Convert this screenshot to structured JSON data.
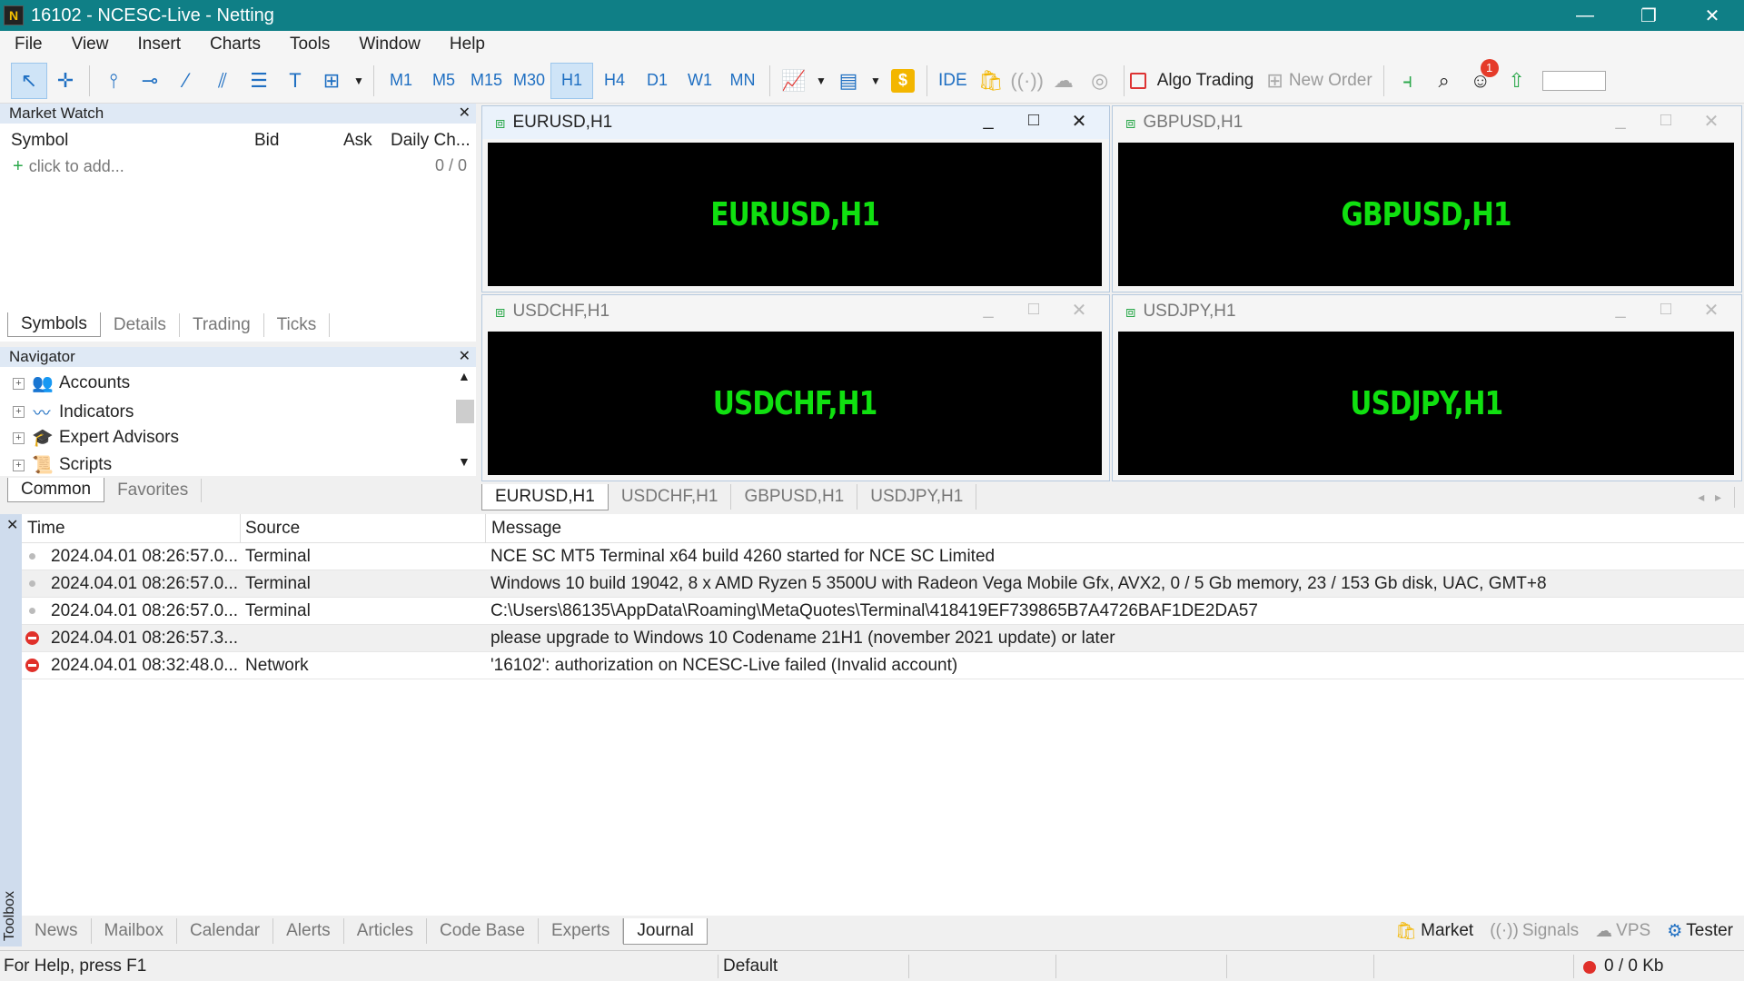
{
  "window": {
    "title": "16102 - NCESC-Live - Netting",
    "minimize": "—",
    "restore": "❐",
    "close": "✕"
  },
  "menu": [
    "File",
    "View",
    "Insert",
    "Charts",
    "Tools",
    "Window",
    "Help"
  ],
  "toolbar": {
    "timeframes": [
      "M1",
      "M5",
      "M15",
      "M30",
      "H1",
      "H4",
      "D1",
      "W1",
      "MN"
    ],
    "active_timeframe": "H1",
    "ide_label": "IDE",
    "algo_trading_label": "Algo Trading",
    "new_order_label": "New Order",
    "notification_count": "1",
    "accent_color": "#1f6fc2"
  },
  "market_watch": {
    "title": "Market Watch",
    "columns": [
      "Symbol",
      "Bid",
      "Ask",
      "Daily Ch..."
    ],
    "add_placeholder": "click to add...",
    "count": "0 / 0",
    "tabs": [
      "Symbols",
      "Details",
      "Trading",
      "Ticks"
    ],
    "active_tab": "Symbols"
  },
  "navigator": {
    "title": "Navigator",
    "items": [
      {
        "label": "Accounts",
        "icon": "accounts-icon"
      },
      {
        "label": "Indicators",
        "icon": "indicators-icon"
      },
      {
        "label": "Expert Advisors",
        "icon": "expert-advisors-icon"
      },
      {
        "label": "Scripts",
        "icon": "scripts-icon"
      }
    ],
    "tabs": [
      "Common",
      "Favorites"
    ],
    "active_tab": "Common"
  },
  "charts": [
    {
      "title": "EURUSD,H1",
      "label": "EURUSD,H1",
      "active": true
    },
    {
      "title": "GBPUSD,H1",
      "label": "GBPUSD,H1",
      "active": false
    },
    {
      "title": "USDCHF,H1",
      "label": "USDCHF,H1",
      "active": false
    },
    {
      "title": "USDJPY,H1",
      "label": "USDJPY,H1",
      "active": false
    }
  ],
  "chart_tabs": [
    "EURUSD,H1",
    "USDCHF,H1",
    "GBPUSD,H1",
    "USDJPY,H1"
  ],
  "journal": {
    "columns": [
      "Time",
      "Source",
      "Message"
    ],
    "rows": [
      {
        "level": "info",
        "time": "2024.04.01 08:26:57.0...",
        "source": "Terminal",
        "message": "NCE SC MT5 Terminal x64 build 4260 started for NCE SC Limited"
      },
      {
        "level": "info",
        "time": "2024.04.01 08:26:57.0...",
        "source": "Terminal",
        "message": "Windows 10 build 19042, 8 x AMD Ryzen 5 3500U with Radeon Vega Mobile Gfx, AVX2, 0 / 5 Gb memory, 23 / 153 Gb disk, UAC, GMT+8"
      },
      {
        "level": "info",
        "time": "2024.04.01 08:26:57.0...",
        "source": "Terminal",
        "message": "C:\\Users\\86135\\AppData\\Roaming\\MetaQuotes\\Terminal\\418419EF739865B7A4726BAF1DE2DA57"
      },
      {
        "level": "error",
        "time": "2024.04.01 08:26:57.3...",
        "source": "",
        "message": "please upgrade to Windows 10 Codename 21H1 (november 2021 update) or later"
      },
      {
        "level": "error",
        "time": "2024.04.01 08:32:48.0...",
        "source": "Network",
        "message": "'16102': authorization on NCESC-Live failed (Invalid account)"
      }
    ]
  },
  "toolbox": {
    "label": "Toolbox",
    "tabs": [
      "News",
      "Mailbox",
      "Calendar",
      "Alerts",
      "Articles",
      "Code Base",
      "Experts",
      "Journal"
    ],
    "active_tab": "Journal",
    "right": [
      "Market",
      "Signals",
      "VPS",
      "Tester"
    ]
  },
  "status": {
    "help": "For Help, press F1",
    "profile": "Default",
    "traffic": "0 / 0 Kb"
  }
}
